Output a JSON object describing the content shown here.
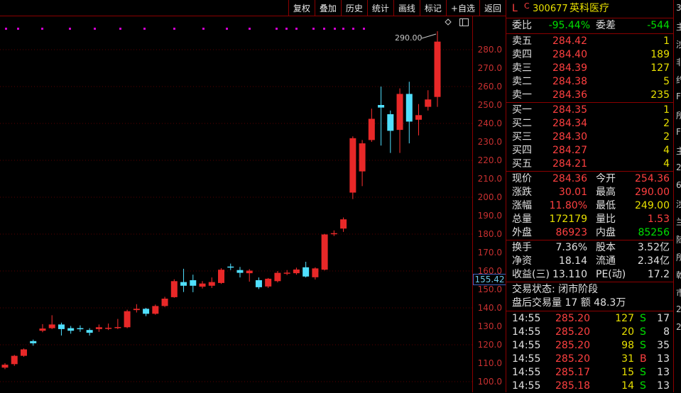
{
  "toolbar": {
    "buttons": [
      "复权",
      "叠加",
      "历史",
      "统计",
      "画线",
      "标记",
      "+自选",
      "返回"
    ]
  },
  "chart": {
    "high_label": "290.00",
    "last_price": "155.42",
    "y_ticks": [
      "280.0",
      "270.0",
      "260.0",
      "250.0",
      "240.0",
      "230.0",
      "220.0",
      "210.0",
      "200.0",
      "190.0",
      "180.0",
      "170.0",
      "160.0",
      "150.0",
      "140.0",
      "130.0",
      "120.0",
      "110.0",
      "100.0"
    ],
    "candles": [
      {
        "o": 107.6,
        "c": 109.2,
        "h": 110.0,
        "l": 106.8
      },
      {
        "o": 109.5,
        "c": 114.0,
        "h": 114.5,
        "l": 108.6
      },
      {
        "o": 114.0,
        "c": 117.5,
        "h": 118.0,
        "l": 113.5
      },
      {
        "o": 122.0,
        "c": 120.8,
        "h": 122.8,
        "l": 119.5
      },
      {
        "o": 127.6,
        "c": 128.8,
        "h": 131.2,
        "l": 126.8
      },
      {
        "o": 129.0,
        "c": 131.0,
        "h": 136.0,
        "l": 128.5
      },
      {
        "o": 131.0,
        "c": 128.5,
        "h": 132.0,
        "l": 125.0
      },
      {
        "o": 129.0,
        "c": 127.6,
        "h": 130.2,
        "l": 126.0
      },
      {
        "o": 129.0,
        "c": 128.9,
        "h": 130.5,
        "l": 127.0
      },
      {
        "o": 128.0,
        "c": 126.5,
        "h": 129.0,
        "l": 125.0
      },
      {
        "o": 128.5,
        "c": 129.5,
        "h": 131.0,
        "l": 127.0
      },
      {
        "o": 129.0,
        "c": 129.2,
        "h": 131.5,
        "l": 128.0
      },
      {
        "o": 129.2,
        "c": 129.6,
        "h": 134.0,
        "l": 128.5
      },
      {
        "o": 129.5,
        "c": 138.2,
        "h": 139.0,
        "l": 129.0
      },
      {
        "o": 138.8,
        "c": 139.5,
        "h": 142.0,
        "l": 137.5
      },
      {
        "o": 139.5,
        "c": 136.8,
        "h": 140.0,
        "l": 135.5
      },
      {
        "o": 136.8,
        "c": 141.0,
        "h": 141.8,
        "l": 136.3
      },
      {
        "o": 141.0,
        "c": 145.0,
        "h": 146.0,
        "l": 140.5
      },
      {
        "o": 145.8,
        "c": 154.5,
        "h": 155.5,
        "l": 145.5
      },
      {
        "o": 154.0,
        "c": 152.0,
        "h": 161.2,
        "l": 148.6
      },
      {
        "o": 155.0,
        "c": 152.0,
        "h": 158.0,
        "l": 148.5
      },
      {
        "o": 151.5,
        "c": 153.2,
        "h": 154.5,
        "l": 150.5
      },
      {
        "o": 152.0,
        "c": 154.0,
        "h": 156.5,
        "l": 150.8
      },
      {
        "o": 153.5,
        "c": 160.7,
        "h": 161.5,
        "l": 153.0
      },
      {
        "o": 162.4,
        "c": 162.2,
        "h": 164.0,
        "l": 160.5
      },
      {
        "o": 160.5,
        "c": 159.0,
        "h": 162.2,
        "l": 156.5
      },
      {
        "o": 158.8,
        "c": 160.2,
        "h": 161.0,
        "l": 154.2
      },
      {
        "o": 155.0,
        "c": 151.2,
        "h": 156.5,
        "l": 150.2
      },
      {
        "o": 151.6,
        "c": 155.8,
        "h": 156.2,
        "l": 150.8
      },
      {
        "o": 154.5,
        "c": 159.0,
        "h": 160.0,
        "l": 153.8
      },
      {
        "o": 159.0,
        "c": 159.1,
        "h": 160.5,
        "l": 157.8
      },
      {
        "o": 158.8,
        "c": 160.8,
        "h": 161.8,
        "l": 158.0
      },
      {
        "o": 162.0,
        "c": 157.0,
        "h": 165.0,
        "l": 156.5
      },
      {
        "o": 156.6,
        "c": 161.4,
        "h": 162.0,
        "l": 155.4
      },
      {
        "o": 160.7,
        "c": 179.8,
        "h": 180.1,
        "l": 160.3
      },
      {
        "o": 180.2,
        "c": 180.5,
        "h": 182.0,
        "l": 179.0
      },
      {
        "o": 183.0,
        "c": 188.0,
        "h": 189.0,
        "l": 181.2
      },
      {
        "o": 202.5,
        "c": 232.0,
        "h": 233.0,
        "l": 199.0
      },
      {
        "o": 214.0,
        "c": 229.2,
        "h": 231.0,
        "l": 206.0
      },
      {
        "o": 231.0,
        "c": 242.5,
        "h": 248.0,
        "l": 230.0
      },
      {
        "o": 250.0,
        "c": 248.6,
        "h": 260.0,
        "l": 228.0
      },
      {
        "o": 245.0,
        "c": 236.0,
        "h": 247.0,
        "l": 224.0
      },
      {
        "o": 236.5,
        "c": 256.0,
        "h": 259.0,
        "l": 224.0
      },
      {
        "o": 256.0,
        "c": 241.0,
        "h": 262.6,
        "l": 229.2
      },
      {
        "o": 242.0,
        "c": 244.5,
        "h": 250.5,
        "l": 233.5
      },
      {
        "o": 249.0,
        "c": 253.0,
        "h": 258.0,
        "l": 247.0
      },
      {
        "o": 254.36,
        "c": 284.36,
        "h": 290.0,
        "l": 249.0
      }
    ]
  },
  "panel": {
    "header": {
      "l": "L",
      "c": "C",
      "code": "300677",
      "name": "英科医疗"
    },
    "weibi": {
      "l1": "委比",
      "v1": "-95.44%",
      "l2": "委差",
      "v2": "-544"
    },
    "asks": [
      {
        "label": "卖五",
        "price": "284.42",
        "vol": "1"
      },
      {
        "label": "卖四",
        "price": "284.40",
        "vol": "189"
      },
      {
        "label": "卖三",
        "price": "284.39",
        "vol": "127"
      },
      {
        "label": "卖二",
        "price": "284.38",
        "vol": "5"
      },
      {
        "label": "卖一",
        "price": "284.36",
        "vol": "235"
      }
    ],
    "bids": [
      {
        "label": "买一",
        "price": "284.35",
        "vol": "1"
      },
      {
        "label": "买二",
        "price": "284.34",
        "vol": "2"
      },
      {
        "label": "买三",
        "price": "284.30",
        "vol": "2"
      },
      {
        "label": "买四",
        "price": "284.27",
        "vol": "4"
      },
      {
        "label": "买五",
        "price": "284.21",
        "vol": "4"
      }
    ],
    "stats": [
      {
        "l1": "现价",
        "v1": "284.36",
        "l2": "今开",
        "v2": "254.36"
      },
      {
        "l1": "涨跌",
        "v1": "30.01",
        "l2": "最高",
        "v2": "290.00"
      },
      {
        "l1": "涨幅",
        "v1": "11.80%",
        "l2": "最低",
        "v2": "249.00"
      },
      {
        "l1": "总量",
        "v1": "172179",
        "l2": "量比",
        "v2": "1.53"
      },
      {
        "l1": "外盘",
        "v1": "86923",
        "l2": "内盘",
        "v2": "85256"
      }
    ],
    "fund": [
      {
        "l1": "换手",
        "v1": "7.36%",
        "l2": "股本",
        "v2": "3.52亿"
      },
      {
        "l1": "净资",
        "v1": "18.14",
        "l2": "流通",
        "v2": "2.34亿"
      },
      {
        "l1": "收益(三)",
        "v1": "13.110",
        "l2": "PE(动)",
        "v2": "17.2"
      }
    ],
    "status": {
      "line1": "交易状态: 闭市阶段",
      "line2": "盘后交易量 17 额 48.3万"
    },
    "trades": [
      {
        "time": "14:55",
        "price": "285.20",
        "vol": "127",
        "side": "S",
        "n": "17"
      },
      {
        "time": "14:55",
        "price": "285.20",
        "vol": "20",
        "side": "S",
        "n": "8"
      },
      {
        "time": "14:55",
        "price": "285.20",
        "vol": "98",
        "side": "S",
        "n": "35"
      },
      {
        "time": "14:55",
        "price": "285.20",
        "vol": "31",
        "side": "B",
        "n": "13"
      },
      {
        "time": "14:55",
        "price": "285.17",
        "vol": "15",
        "side": "S",
        "n": "13"
      },
      {
        "time": "14:55",
        "price": "285.18",
        "vol": "14",
        "side": "S",
        "n": "13"
      }
    ]
  },
  "edge": {
    "chars": [
      "3",
      "主",
      "涉",
      "非",
      "约",
      "F",
      "所",
      "F",
      "主",
      "2",
      "6",
      "涉",
      "兰",
      "随",
      "所",
      "乾",
      "市",
      "2",
      "2"
    ]
  }
}
